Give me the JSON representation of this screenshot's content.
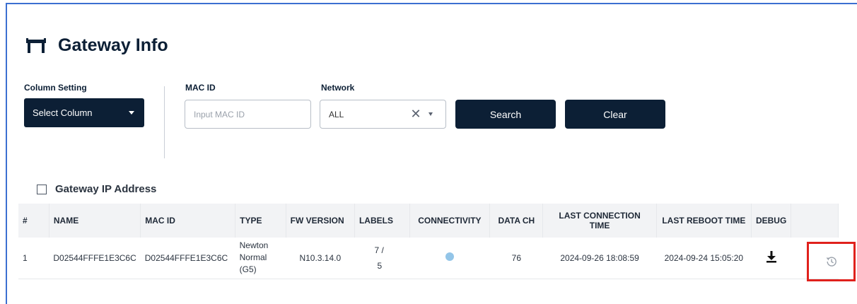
{
  "header": {
    "title": "Gateway Info",
    "icon": "gateway-icon"
  },
  "filters": {
    "column_setting_label": "Column Setting",
    "select_column_label": "Select Column",
    "mac_id_label": "MAC ID",
    "mac_id_placeholder": "Input MAC ID",
    "network_label": "Network",
    "network_value": "ALL",
    "search_label": "Search",
    "clear_label": "Clear"
  },
  "toggle": {
    "label": "Gateway IP Address",
    "checked": false
  },
  "table": {
    "columns": [
      "#",
      "NAME",
      "MAC ID",
      "TYPE",
      "FW VERSION",
      "LABELS",
      "CONNECTIVITY",
      "DATA CH",
      "LAST CONNECTION TIME",
      "LAST REBOOT TIME",
      "DEBUG",
      ""
    ],
    "rows": [
      {
        "index": "1",
        "name": "D02544FFFE1E3C6C",
        "mac_id": "D02544FFFE1E3C6C",
        "type_lines": [
          "Newton",
          "Normal",
          "(G5)"
        ],
        "fw_version": "N10.3.14.0",
        "labels_top": "7  /",
        "labels_bottom": "5",
        "connectivity_color": "#93c5e8",
        "data_ch": "76",
        "last_connection_time": "2024-09-26 18:08:59",
        "last_reboot_time": "2024-09-24 15:05:20",
        "debug_icon": "download-icon",
        "history_icon": "history-icon"
      }
    ]
  },
  "colors": {
    "primary": "#0c1f35",
    "highlight": "#e0211c",
    "frame": "#3c6fd1"
  }
}
